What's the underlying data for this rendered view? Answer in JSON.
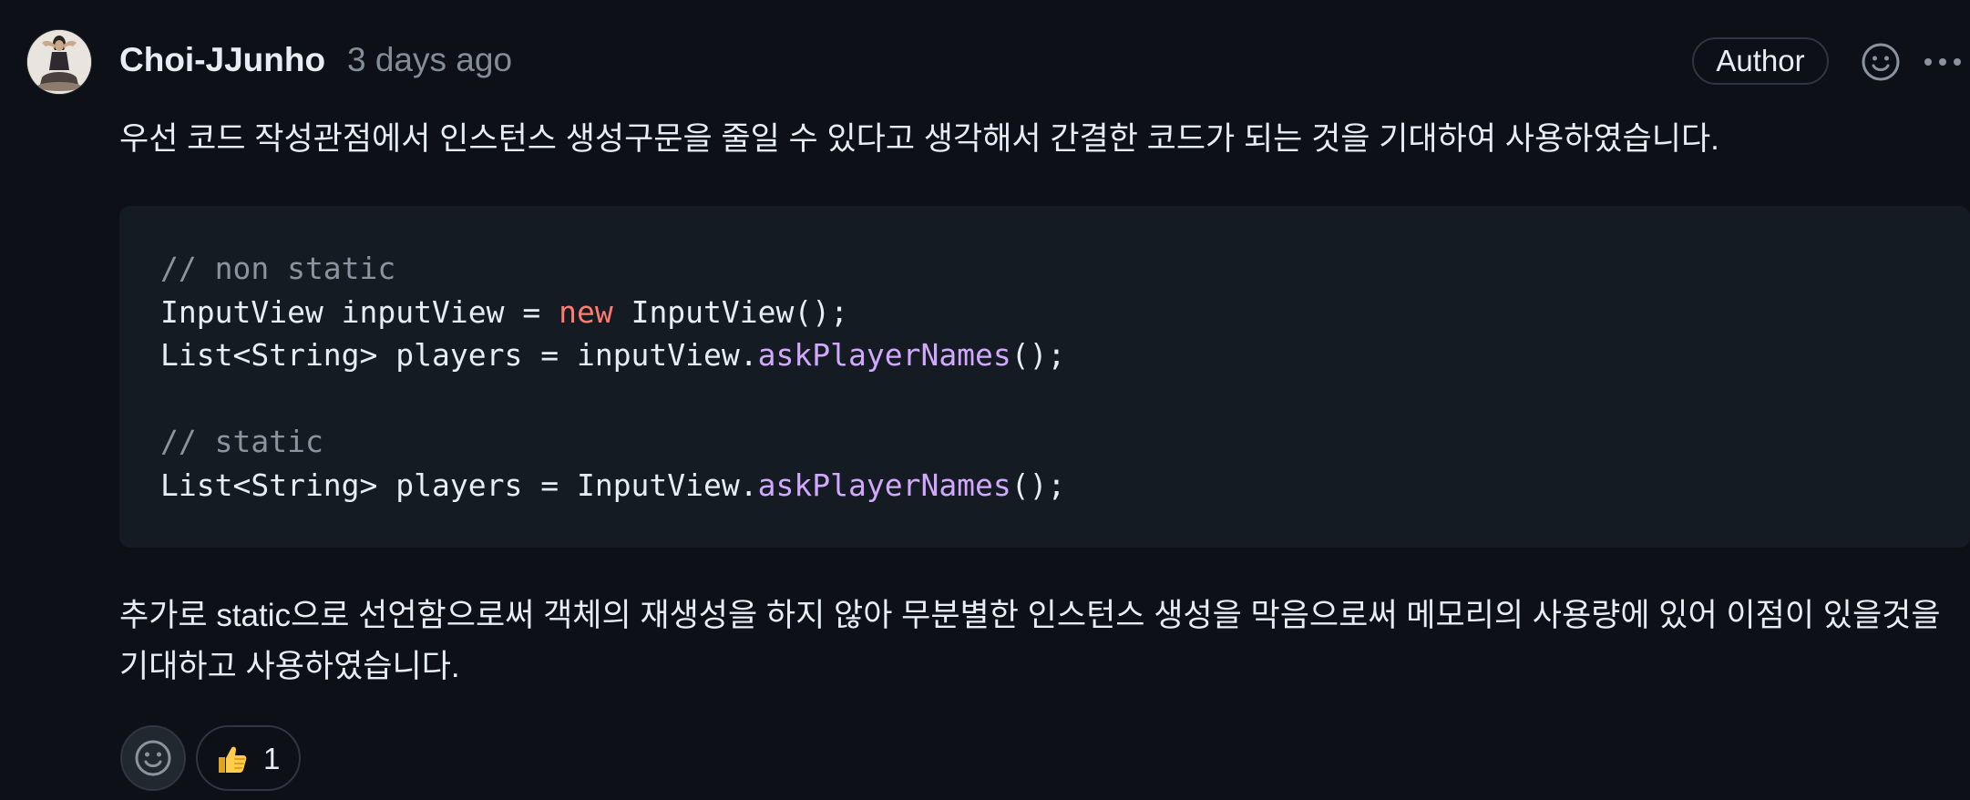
{
  "comment": {
    "author": "Choi-JJunho",
    "timestamp": "3 days ago",
    "author_badge": "Author",
    "paragraph_1": "우선 코드 작성관점에서 인스턴스 생성구문을 줄일 수 있다고 생각해서 간결한 코드가 되는 것을 기대하여 사용하였습니다.",
    "paragraph_2": "추가로 static으로 선언함으로써 객체의 재생성을 하지 않아 무분별한 인스턴스 생성을 막음으로써 메모리의 사용량에 있어 이점이 있을것을 기대하고 사용하였습니다."
  },
  "code": {
    "comment_1": "// non static",
    "line_1_a": "InputView inputView = ",
    "line_1_kw": "new",
    "line_1_b": " InputView();",
    "line_2_a": "List<String> players = inputView.",
    "line_2_fn": "askPlayerNames",
    "line_2_b": "();",
    "comment_2": "// static",
    "line_3_a": "List<String> players = InputView.",
    "line_3_fn": "askPlayerNames",
    "line_3_b": "();"
  },
  "reactions": [
    {
      "emoji": "thumbs-up-icon",
      "count": "1"
    }
  ],
  "colors": {
    "background": "#0d1117",
    "code_background": "#151b23",
    "text": "#e6edf3",
    "muted": "#848d97",
    "keyword": "#ff7b72",
    "function": "#d2a8ff",
    "border": "#30363d"
  }
}
